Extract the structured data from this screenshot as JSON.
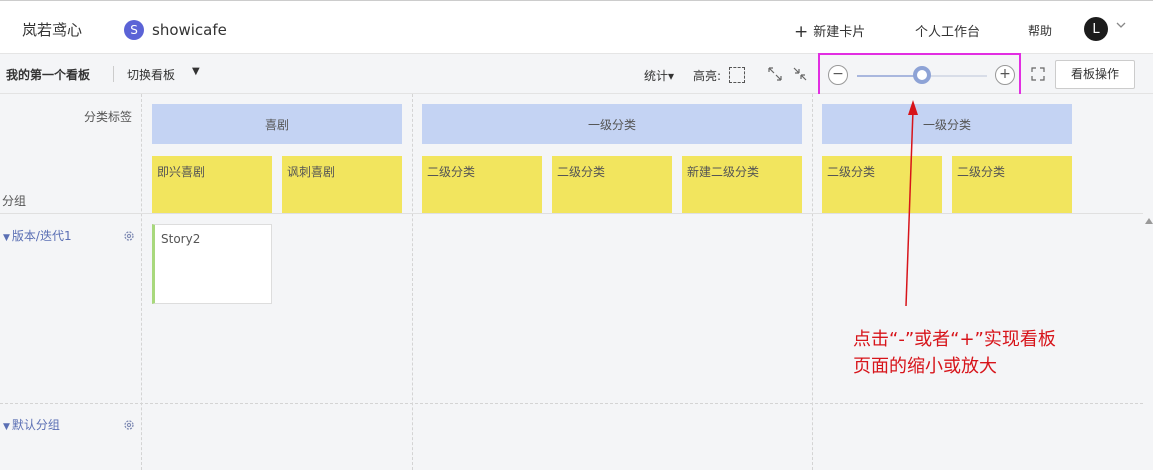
{
  "header": {
    "brand": "岚若鸢心",
    "project_badge": "S",
    "project_name": "showicafe",
    "new_card_label": "新建卡片",
    "workspace_label": "个人工作台",
    "help_label": "帮助",
    "avatar_initial": "L"
  },
  "toolbar": {
    "board_name": "我的第一个看板",
    "switch_board_label": "切换看板",
    "stats_label": "统计▾",
    "highlight_label": "高亮:",
    "zoom_level": 0.5,
    "zoom_minus": "−",
    "zoom_plus": "+",
    "board_ops_label": "看板操作"
  },
  "board": {
    "category_label": "分类标签",
    "group_label": "分组",
    "level1": [
      "喜剧",
      "一级分类",
      "一级分类"
    ],
    "level2": [
      "即兴喜剧",
      "讽刺喜剧",
      "二级分类",
      "二级分类",
      "新建二级分类",
      "二级分类",
      "二级分类"
    ],
    "swimlanes": [
      "版本/迭代1",
      "默认分组"
    ],
    "cards": [
      {
        "title": "Story2"
      }
    ]
  },
  "annotation": {
    "line1": "点击“-”或者“+”实现看板",
    "line2": "页面的缩小或放大"
  },
  "colors": {
    "level1": "#c4d3f3",
    "level2": "#f2e55e",
    "highlight_frame": "#e22ee2",
    "annotation": "#d7141a",
    "swimlane_text": "#5a6fb4"
  }
}
